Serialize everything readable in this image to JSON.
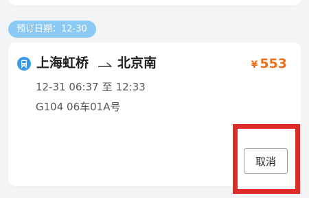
{
  "booking": {
    "date_chip": "预订日期：12-30"
  },
  "trip": {
    "icon": "train-icon",
    "from_station": "上海虹桥",
    "to_station": "北京南",
    "arrow_icon": "one-way-arrow-icon",
    "currency": "¥",
    "price": "553",
    "depart": "12-31 06:37",
    "to_word": "至",
    "arrive": "12:33",
    "seat_info": "G104 06车01A号"
  },
  "actions": {
    "cancel_label": "取消"
  },
  "colors": {
    "chip_bg": "#8ccaf6",
    "price": "#ef6e16",
    "icon_bg": "#3a98ea",
    "highlight": "#dd2c28"
  }
}
